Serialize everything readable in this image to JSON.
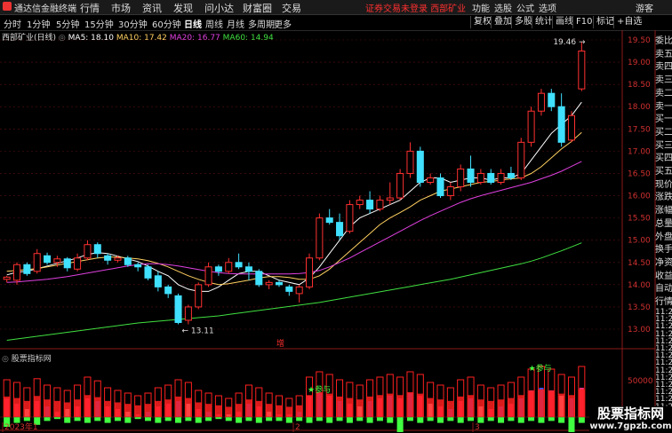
{
  "app": {
    "title": "通达信金融终端",
    "menu": [
      "行情",
      "市场",
      "资讯",
      "发现",
      "问小达",
      "财富圈",
      "交易"
    ],
    "login_warning": "证券交易未登录",
    "stock_short": "西部矿业",
    "right_menu": [
      "功能",
      "选股",
      "公式",
      "选项"
    ],
    "guest": "游客"
  },
  "periods": [
    "分时",
    "1分钟",
    "5分钟",
    "15分钟",
    "30分钟",
    "60分钟",
    "日线",
    "周线",
    "月线",
    "多周期",
    "更多"
  ],
  "active_period": "日线",
  "toolbar": [
    "复权",
    "叠加",
    "多股",
    "统计",
    "画线",
    "F10",
    "标记",
    "+自选"
  ],
  "stock": {
    "name": "西部矿业(日线)",
    "ma_labels": [
      {
        "text": "MA5: 18.10",
        "color": "#ffffff"
      },
      {
        "text": "MA10: 17.42",
        "color": "#ffd060"
      },
      {
        "text": "MA20: 16.77",
        "color": "#e040e0"
      },
      {
        "text": "MA60: 14.94",
        "color": "#40e040"
      }
    ]
  },
  "annotations": {
    "high": "19.46",
    "low": "13.11",
    "zeng": "增"
  },
  "price_axis": [
    "19.50",
    "19.00",
    "18.50",
    "18.00",
    "17.50",
    "17.00",
    "16.50",
    "16.00",
    "15.50",
    "15.00",
    "14.50",
    "14.00",
    "13.50",
    "13.00"
  ],
  "side_labels": [
    "委比",
    "卖五",
    "卖四",
    "卖三",
    "卖二",
    "卖一",
    "买一",
    "买二",
    "买三",
    "买四",
    "买五",
    "现价",
    "涨跌",
    "涨幅",
    "总量",
    "外盘",
    "换手",
    "净资",
    "收益",
    "自动",
    "行情"
  ],
  "side_times": [
    "11:2",
    "11:2",
    "11:2",
    "11:2",
    "11:2",
    "11:2",
    "11:2",
    "11:2",
    "11:2",
    "11:2",
    "11:2",
    "11:2",
    "11:2",
    "11:2",
    "11:2",
    "11:2",
    "11:2"
  ],
  "indicator": {
    "name": "股票指标网",
    "axis_label": "50000",
    "signal_labels": [
      "参与",
      "参与"
    ]
  },
  "date_axis": [
    "2023年1",
    "2",
    "3"
  ],
  "watermark": {
    "title": "股票指标网",
    "url": "www.7gpzb.com"
  },
  "chart_data": {
    "type": "candlestick",
    "ylim": [
      13.0,
      19.5
    ],
    "up_color": "#ff3030",
    "down_color": "#40e0ff",
    "candles": [
      [
        14.12,
        14.17,
        14.05,
        14.2
      ],
      [
        14.1,
        14.45,
        14.0,
        14.5
      ],
      [
        14.45,
        14.25,
        14.2,
        14.5
      ],
      [
        14.3,
        14.7,
        14.25,
        14.8
      ],
      [
        14.65,
        14.5,
        14.45,
        14.72
      ],
      [
        14.5,
        14.58,
        14.4,
        14.65
      ],
      [
        14.58,
        14.38,
        14.3,
        14.62
      ],
      [
        14.35,
        14.6,
        14.3,
        14.7
      ],
      [
        14.6,
        14.9,
        14.55,
        15.0
      ],
      [
        14.9,
        14.7,
        14.6,
        14.95
      ],
      [
        14.65,
        14.55,
        14.45,
        14.7
      ],
      [
        14.55,
        14.6,
        14.5,
        14.65
      ],
      [
        14.6,
        14.45,
        14.4,
        14.65
      ],
      [
        14.45,
        14.4,
        14.3,
        14.5
      ],
      [
        14.4,
        14.15,
        14.1,
        14.45
      ],
      [
        14.2,
        13.95,
        13.85,
        14.3
      ],
      [
        13.95,
        13.8,
        13.7,
        14.0
      ],
      [
        13.75,
        13.15,
        13.11,
        13.8
      ],
      [
        13.2,
        13.5,
        13.11,
        13.55
      ],
      [
        13.5,
        14.0,
        13.45,
        14.05
      ],
      [
        14.0,
        14.4,
        13.95,
        14.5
      ],
      [
        14.4,
        14.3,
        14.2,
        14.45
      ],
      [
        14.3,
        14.5,
        14.25,
        14.6
      ],
      [
        14.5,
        14.4,
        14.35,
        14.7
      ],
      [
        14.4,
        14.3,
        14.1,
        14.5
      ],
      [
        14.3,
        14.0,
        13.95,
        14.35
      ],
      [
        14.0,
        14.05,
        13.9,
        14.1
      ],
      [
        14.05,
        14.0,
        13.95,
        14.1
      ],
      [
        13.95,
        13.85,
        13.75,
        14.0
      ],
      [
        13.8,
        13.95,
        13.6,
        14.0
      ],
      [
        13.95,
        14.6,
        13.9,
        14.7
      ],
      [
        14.6,
        15.5,
        14.55,
        15.6
      ],
      [
        15.5,
        15.4,
        15.35,
        15.7
      ],
      [
        15.4,
        15.1,
        15.0,
        15.6
      ],
      [
        15.2,
        15.8,
        15.15,
        15.9
      ],
      [
        15.8,
        15.9,
        15.7,
        16.0
      ],
      [
        15.9,
        15.7,
        15.6,
        16.1
      ],
      [
        15.7,
        15.9,
        15.65,
        16.0
      ],
      [
        15.9,
        15.95,
        15.8,
        16.3
      ],
      [
        15.95,
        16.5,
        15.9,
        16.6
      ],
      [
        16.5,
        17.0,
        16.4,
        17.2
      ],
      [
        17.0,
        16.3,
        16.2,
        17.1
      ],
      [
        16.3,
        16.4,
        16.25,
        16.5
      ],
      [
        16.4,
        16.0,
        15.95,
        16.5
      ],
      [
        16.0,
        16.2,
        15.9,
        16.3
      ],
      [
        16.2,
        16.6,
        16.1,
        16.7
      ],
      [
        16.6,
        16.3,
        16.2,
        16.9
      ],
      [
        16.3,
        16.5,
        16.25,
        16.6
      ],
      [
        16.5,
        16.3,
        16.25,
        16.6
      ],
      [
        16.3,
        16.5,
        16.25,
        16.6
      ],
      [
        16.5,
        16.4,
        16.35,
        16.65
      ],
      [
        16.4,
        17.2,
        16.35,
        17.3
      ],
      [
        17.2,
        17.9,
        17.1,
        18.0
      ],
      [
        17.9,
        18.3,
        17.8,
        18.4
      ],
      [
        18.3,
        18.0,
        17.9,
        18.4
      ],
      [
        18.0,
        17.2,
        17.1,
        18.3
      ],
      [
        17.25,
        17.8,
        17.2,
        17.9
      ],
      [
        18.4,
        19.25,
        18.35,
        19.46
      ]
    ],
    "ma_lines": {
      "MA5": [
        14.22,
        14.28,
        14.3,
        14.36,
        14.42,
        14.48,
        14.54,
        14.6,
        14.68,
        14.72,
        14.7,
        14.64,
        14.58,
        14.52,
        14.42,
        14.3,
        14.2,
        14.0,
        13.9,
        13.85,
        13.85,
        13.95,
        14.1,
        14.25,
        14.3,
        14.3,
        14.2,
        14.1,
        14.05,
        14.0,
        14.15,
        14.4,
        14.7,
        15.0,
        15.3,
        15.5,
        15.6,
        15.7,
        15.8,
        15.9,
        16.1,
        16.3,
        16.4,
        16.4,
        16.3,
        16.35,
        16.4,
        16.4,
        16.35,
        16.4,
        16.4,
        16.5,
        16.8,
        17.1,
        17.4,
        17.6,
        17.8,
        18.1
      ],
      "MA10": [
        14.3,
        14.32,
        14.34,
        14.36,
        14.4,
        14.44,
        14.48,
        14.52,
        14.56,
        14.6,
        14.62,
        14.62,
        14.6,
        14.58,
        14.54,
        14.48,
        14.4,
        14.3,
        14.2,
        14.12,
        14.05,
        14.0,
        14.02,
        14.06,
        14.1,
        14.15,
        14.18,
        14.18,
        14.16,
        14.12,
        14.12,
        14.2,
        14.35,
        14.55,
        14.75,
        14.95,
        15.15,
        15.35,
        15.5,
        15.62,
        15.75,
        15.9,
        16.0,
        16.1,
        16.15,
        16.2,
        16.25,
        16.3,
        16.32,
        16.35,
        16.38,
        16.4,
        16.5,
        16.65,
        16.85,
        17.05,
        17.22,
        17.42
      ],
      "MA20": [
        14.05,
        14.06,
        14.08,
        14.1,
        14.12,
        14.15,
        14.18,
        14.22,
        14.26,
        14.3,
        14.34,
        14.38,
        14.42,
        14.45,
        14.47,
        14.47,
        14.45,
        14.42,
        14.38,
        14.34,
        14.3,
        14.27,
        14.25,
        14.24,
        14.24,
        14.24,
        14.24,
        14.24,
        14.24,
        14.25,
        14.27,
        14.32,
        14.4,
        14.5,
        14.6,
        14.72,
        14.84,
        14.96,
        15.08,
        15.2,
        15.32,
        15.44,
        15.55,
        15.65,
        15.75,
        15.85,
        15.93,
        16.0,
        16.06,
        16.12,
        16.18,
        16.24,
        16.3,
        16.38,
        16.46,
        16.55,
        16.66,
        16.77
      ],
      "MA60": [
        12.75,
        12.78,
        12.81,
        12.84,
        12.87,
        12.9,
        12.93,
        12.96,
        12.99,
        13.02,
        13.05,
        13.08,
        13.11,
        13.14,
        13.16,
        13.18,
        13.2,
        13.22,
        13.24,
        13.26,
        13.28,
        13.3,
        13.33,
        13.36,
        13.39,
        13.42,
        13.45,
        13.48,
        13.51,
        13.54,
        13.57,
        13.6,
        13.64,
        13.68,
        13.72,
        13.76,
        13.8,
        13.84,
        13.88,
        13.92,
        13.96,
        14.0,
        14.04,
        14.08,
        14.12,
        14.17,
        14.22,
        14.27,
        14.32,
        14.37,
        14.42,
        14.47,
        14.53,
        14.6,
        14.68,
        14.76,
        14.85,
        14.94
      ]
    },
    "indicator_bars": {
      "main": [
        0.7,
        0.65,
        0.55,
        0.72,
        0.6,
        0.55,
        0.5,
        0.6,
        0.75,
        0.68,
        0.55,
        0.5,
        0.45,
        0.4,
        0.45,
        0.55,
        0.6,
        0.7,
        0.65,
        0.5,
        0.45,
        0.4,
        0.35,
        0.45,
        0.6,
        0.55,
        0.45,
        0.4,
        0.35,
        0.4,
        0.75,
        0.85,
        0.8,
        0.7,
        0.65,
        0.6,
        0.7,
        0.75,
        0.8,
        0.75,
        0.85,
        0.8,
        0.65,
        0.6,
        0.55,
        0.7,
        0.75,
        0.6,
        0.55,
        0.6,
        0.65,
        0.75,
        0.9,
        0.95,
        0.9,
        0.8,
        0.75,
        0.95
      ],
      "inner": [
        0.35,
        0.25,
        0.15,
        0.3,
        0.2,
        0.1,
        0.15,
        0.2,
        0.35,
        0.3,
        0.2,
        0.15,
        0.1,
        0.05,
        0.1,
        0.2,
        0.25,
        0.3,
        0.25,
        0.15,
        0.1,
        0.05,
        0.05,
        0.1,
        0.25,
        0.2,
        0.1,
        0.05,
        0.05,
        0.1,
        0.4,
        0.45,
        0.4,
        0.3,
        0.25,
        0.2,
        0.3,
        0.35,
        0.4,
        0.35,
        0.45,
        0.4,
        0.25,
        0.2,
        0.15,
        0.3,
        0.35,
        0.2,
        0.15,
        0.2,
        0.25,
        0.35,
        0.5,
        0.55,
        0.5,
        0.4,
        0.35,
        0.55
      ],
      "inner_color": [
        "#ff3080",
        "#ff3080",
        "#ffffff",
        "#ff3080",
        "#3050ff",
        "#ff3080",
        "#ffffff",
        "#ff3080",
        "#ff3080",
        "#3050ff",
        "#ff3080",
        "#ff3080",
        "#ffffff",
        "#ff3080",
        "#3050ff",
        "#ff3080",
        "#ff3080",
        "#3050ff",
        "#ffffff",
        "#ff3080",
        "#3050ff",
        "#ff3080",
        "#ffffff",
        "#ff3080",
        "#3050ff",
        "#ff3080",
        "#ffffff",
        "#ff3080",
        "#ff3080",
        "#3050ff",
        "#ff3080",
        "#3050ff",
        "#ff3080",
        "#3050ff",
        "#ff3080",
        "#ffffff",
        "#3050ff",
        "#ff3080",
        "#3050ff",
        "#ff3080",
        "#3050ff",
        "#ff3080",
        "#ffffff",
        "#ff3080",
        "#3050ff",
        "#ff3080",
        "#3050ff",
        "#ffffff",
        "#ff3080",
        "#3050ff",
        "#ff3080",
        "#3050ff",
        "#ff3080",
        "#3050ff",
        "#ff3080",
        "#ffffff",
        "#3050ff",
        "#ff3080"
      ],
      "green": [
        0.5,
        0.3,
        0.2,
        0.4,
        0.2,
        0.1,
        0.3,
        0.2,
        0.3,
        0.2,
        0.3,
        0.2,
        0.3,
        0.1,
        0.2,
        0.3,
        0.2,
        0.3,
        0.2,
        0.3,
        0.2,
        0.1,
        0.2,
        0.3,
        0.2,
        0.3,
        0.2,
        0.2,
        0.3,
        0.2,
        0.3,
        0.2,
        0.3,
        0.2,
        0.3,
        0.2,
        0.3,
        0.2,
        0.3,
        0.9,
        0.2,
        0.3,
        0.2,
        0.3,
        0.2,
        0.3,
        0.2,
        0.3,
        0.2,
        0.3,
        0.2,
        0.3,
        0.2,
        0.3,
        0.2,
        0.3,
        1.0,
        0.3
      ]
    }
  }
}
